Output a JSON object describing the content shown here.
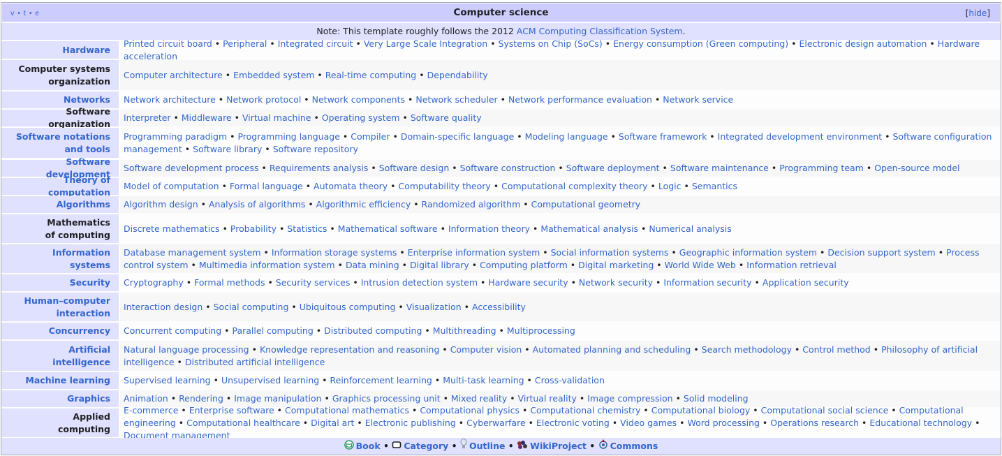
{
  "title": {
    "vte": [
      "v",
      "t",
      "e"
    ],
    "text": "Computer science",
    "hide_label": "hide"
  },
  "note": {
    "prefix": "Note: This template roughly follows the 2012 ",
    "link": "ACM Computing Classification System",
    "suffix": "."
  },
  "groups": [
    {
      "label": [
        "Hardware"
      ],
      "link": true,
      "items": [
        "Printed circuit board",
        "Peripheral",
        "Integrated circuit",
        "Very Large Scale Integration",
        "Systems on Chip (SoCs)",
        "Energy consumption (Green computing)",
        "Electronic design automation",
        "Hardware acceleration"
      ]
    },
    {
      "label": [
        "Computer systems",
        "organization"
      ],
      "link": false,
      "items": [
        "Computer architecture",
        "Embedded system",
        "Real-time computing",
        "Dependability"
      ]
    },
    {
      "label": [
        "Networks"
      ],
      "link": true,
      "items": [
        "Network architecture",
        "Network protocol",
        "Network components",
        "Network scheduler",
        "Network performance evaluation",
        "Network service"
      ]
    },
    {
      "label": [
        "Software organization"
      ],
      "link": false,
      "items": [
        "Interpreter",
        "Middleware",
        "Virtual machine",
        "Operating system",
        "Software quality"
      ]
    },
    {
      "label": [
        "Software notations",
        "and tools"
      ],
      "link": true,
      "items": [
        "Programming paradigm",
        "Programming language",
        "Compiler",
        "Domain-specific language",
        "Modeling language",
        "Software framework",
        "Integrated development environment",
        "Software configuration management",
        "Software library",
        "Software repository"
      ]
    },
    {
      "label": [
        "Software development"
      ],
      "link": true,
      "items": [
        "Software development process",
        "Requirements analysis",
        "Software design",
        "Software construction",
        "Software deployment",
        "Software maintenance",
        "Programming team",
        "Open-source model"
      ]
    },
    {
      "label": [
        "Theory of computation"
      ],
      "link": true,
      "items": [
        "Model of computation",
        "Formal language",
        "Automata theory",
        "Computability theory",
        "Computational complexity theory",
        "Logic",
        "Semantics"
      ]
    },
    {
      "label": [
        "Algorithms"
      ],
      "link": true,
      "items": [
        "Algorithm design",
        "Analysis of algorithms",
        "Algorithmic efficiency",
        "Randomized algorithm",
        "Computational geometry"
      ]
    },
    {
      "label": [
        "Mathematics",
        "of computing"
      ],
      "link": false,
      "items": [
        "Discrete mathematics",
        "Probability",
        "Statistics",
        "Mathematical software",
        "Information theory",
        "Mathematical analysis",
        "Numerical analysis"
      ]
    },
    {
      "label": [
        "Information",
        "systems"
      ],
      "link": true,
      "items": [
        "Database management system",
        "Information storage systems",
        "Enterprise information system",
        "Social information systems",
        "Geographic information system",
        "Decision support system",
        "Process control system",
        "Multimedia information system",
        "Data mining",
        "Digital library",
        "Computing platform",
        "Digital marketing",
        "World Wide Web",
        "Information retrieval"
      ]
    },
    {
      "label": [
        "Security"
      ],
      "link": true,
      "items": [
        "Cryptography",
        "Formal methods",
        "Security services",
        "Intrusion detection system",
        "Hardware security",
        "Network security",
        "Information security",
        "Application security"
      ]
    },
    {
      "label": [
        "Human–computer",
        "interaction"
      ],
      "link": true,
      "items": [
        "Interaction design",
        "Social computing",
        "Ubiquitous computing",
        "Visualization",
        "Accessibility"
      ]
    },
    {
      "label": [
        "Concurrency"
      ],
      "link": true,
      "items": [
        "Concurrent computing",
        "Parallel computing",
        "Distributed computing",
        "Multithreading",
        "Multiprocessing"
      ]
    },
    {
      "label": [
        "Artificial",
        "intelligence"
      ],
      "link": true,
      "items": [
        "Natural language processing",
        "Knowledge representation and reasoning",
        "Computer vision",
        "Automated planning and scheduling",
        "Search methodology",
        "Control method",
        "Philosophy of artificial intelligence",
        "Distributed artificial intelligence"
      ]
    },
    {
      "label": [
        "Machine learning"
      ],
      "link": true,
      "items": [
        "Supervised learning",
        "Unsupervised learning",
        "Reinforcement learning",
        "Multi-task learning",
        "Cross-validation"
      ]
    },
    {
      "label": [
        "Graphics"
      ],
      "link": true,
      "items": [
        "Animation",
        "Rendering",
        "Image manipulation",
        "Graphics processing unit",
        "Mixed reality",
        "Virtual reality",
        "Image compression",
        "Solid modeling"
      ]
    },
    {
      "label": [
        "Applied",
        "computing"
      ],
      "link": false,
      "items": [
        "E-commerce",
        "Enterprise software",
        "Computational mathematics",
        "Computational physics",
        "Computational chemistry",
        "Computational biology",
        "Computational social science",
        "Computational engineering",
        "Computational healthcare",
        "Digital art",
        "Electronic publishing",
        "Cyberwarfare",
        "Electronic voting",
        "Video games",
        "Word processing",
        "Operations research",
        "Educational technology",
        "Document management"
      ]
    }
  ],
  "footer": [
    {
      "label": "Book",
      "icon": "book-icon"
    },
    {
      "label": "Category",
      "icon": "category-icon"
    },
    {
      "label": "Outline",
      "icon": "outline-icon"
    },
    {
      "label": "WikiProject",
      "icon": "wikiproject-icon"
    },
    {
      "label": "Commons",
      "icon": "commons-icon"
    }
  ],
  "colors": {
    "title_bg": "#ccccff",
    "group_bg": "#e0e0ff",
    "link": "#3366cc",
    "text": "#202122",
    "border": "#a2a9b1"
  }
}
